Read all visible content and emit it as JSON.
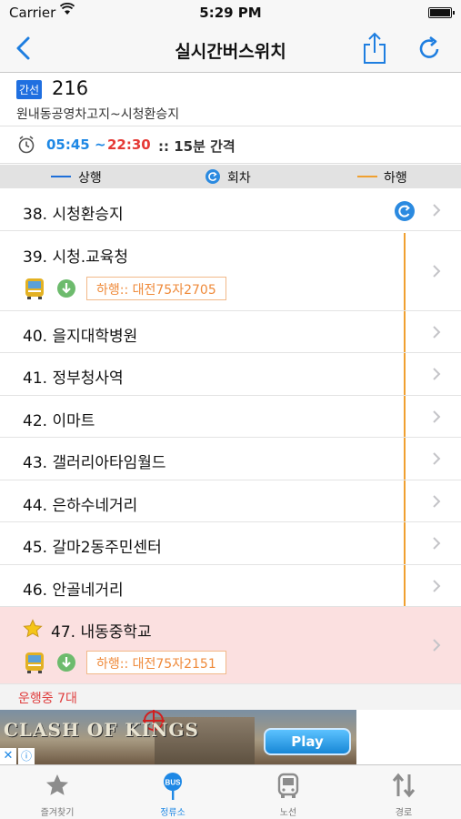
{
  "status_bar": {
    "carrier": "Carrier",
    "time": "5:29 PM"
  },
  "nav": {
    "title": "실시간버스위치"
  },
  "route": {
    "badge": "간선",
    "number": "216",
    "path": "원내동공영차고지~시청환승지"
  },
  "schedule": {
    "start": "05:45 ~",
    "end": "22:30",
    "interval": ":: 15분 간격"
  },
  "legend": {
    "up": "상행",
    "turnaround": "회차",
    "down": "하행"
  },
  "stops": [
    {
      "label": "38. 시청환승지"
    },
    {
      "label": "39. 시청.교육청",
      "bus_tag": "하행:: 대전75자2705"
    },
    {
      "label": "40. 을지대학병원"
    },
    {
      "label": "41. 정부청사역"
    },
    {
      "label": "42. 이마트"
    },
    {
      "label": "43. 갤러리아타임월드"
    },
    {
      "label": "44. 은하수네거리"
    },
    {
      "label": "45. 갈마2동주민센터"
    },
    {
      "label": "46. 안골네거리"
    },
    {
      "label": "47. 내동중학교",
      "bus_tag": "하행:: 대전75자2151"
    }
  ],
  "running_count": "운행중 7대",
  "ad": {
    "logo": "CLASH OF KINGS",
    "button": "Play"
  },
  "tabs": [
    {
      "label": "즐겨찾기"
    },
    {
      "label": "정류소",
      "icon_text": "BUS"
    },
    {
      "label": "노선"
    },
    {
      "label": "경로"
    }
  ],
  "colors": {
    "accent": "#1e88e5",
    "down_line": "#f0a030",
    "highlight": "#fbe0e0",
    "tag_text": "#ef8a3a"
  }
}
